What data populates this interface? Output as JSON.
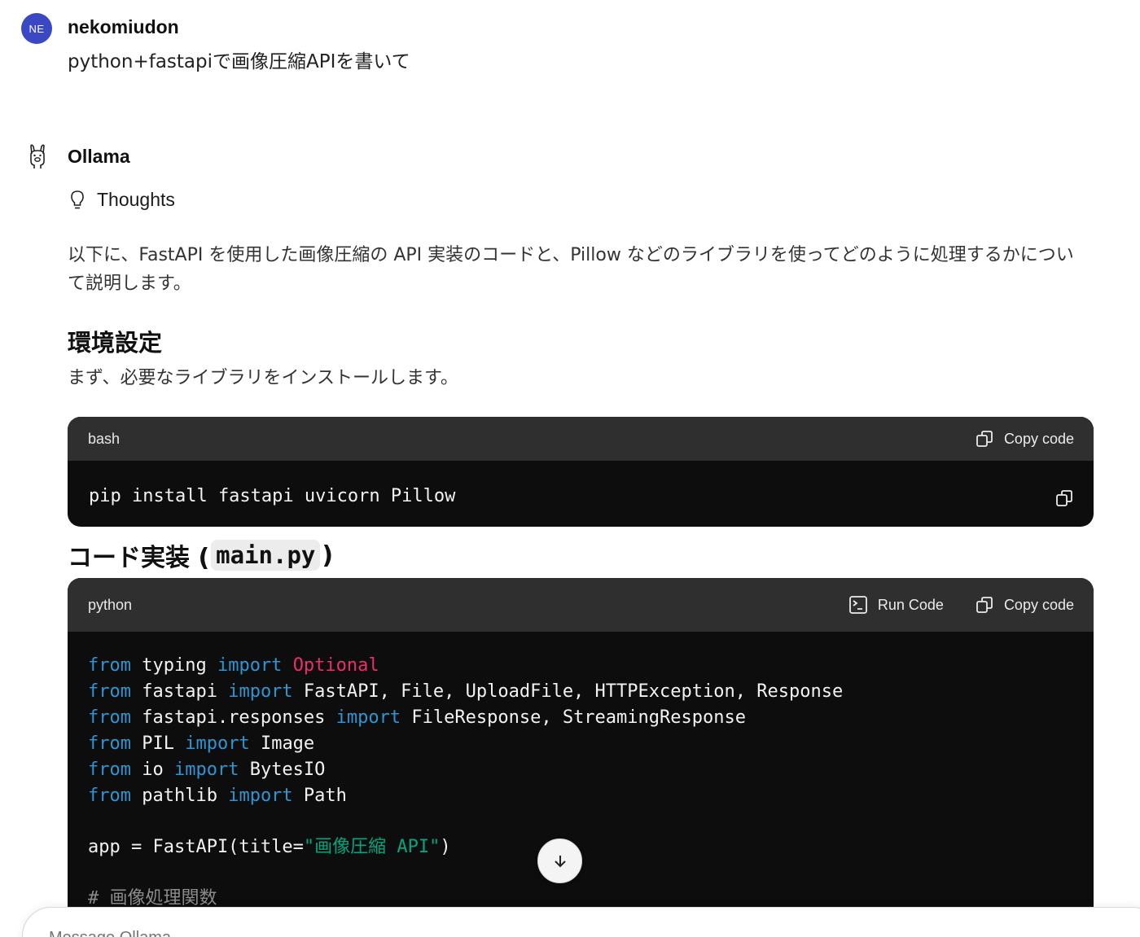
{
  "user": {
    "avatar_initials": "NE",
    "name": "nekomiudon",
    "message": "python+fastapiで画像圧縮APIを書いて"
  },
  "assistant": {
    "name": "Ollama",
    "thoughts_label": "Thoughts",
    "intro": "以下に、FastAPI を使用した画像圧縮の API 実装のコードと、Pillow などのライブラリを使ってどのように処理するかについて説明します。",
    "env_heading": "環境設定",
    "env_text": "まず、必要なライブラリをインストールします。",
    "code_heading_prefix": "コード実装 (",
    "code_heading_file": "main.py",
    "code_heading_suffix": ")"
  },
  "bash_block": {
    "language": "bash",
    "copy_label": "Copy code",
    "code": "pip install fastapi uvicorn Pillow"
  },
  "python_block": {
    "language": "python",
    "run_label": "Run Code",
    "copy_label": "Copy code",
    "lines": {
      "l1": {
        "a": "from",
        "b": " typing ",
        "c": "import",
        "d": " ",
        "e": "Optional"
      },
      "l2": {
        "a": "from",
        "b": " fastapi ",
        "c": "import",
        "d": " FastAPI, File, UploadFile, HTTPException, Response"
      },
      "l3": {
        "a": "from",
        "b": " fastapi.responses ",
        "c": "import",
        "d": " FileResponse, StreamingResponse"
      },
      "l4": {
        "a": "from",
        "b": " PIL ",
        "c": "import",
        "d": " Image"
      },
      "l5": {
        "a": "from",
        "b": " io ",
        "c": "import",
        "d": " BytesIO"
      },
      "l6": {
        "a": "from",
        "b": " pathlib ",
        "c": "import",
        "d": " Path"
      },
      "l7": {
        "a": "app = FastAPI(title=",
        "b": "\"画像圧縮 API\"",
        "c": ")"
      },
      "l8": "# 画像処理関数"
    }
  },
  "composer": {
    "placeholder": "Message Ollama"
  },
  "colors": {
    "keyword": "#2e95d3",
    "class_name": "#e9306c",
    "string": "#00a67d",
    "avatar_bg": "#3b48c4"
  }
}
